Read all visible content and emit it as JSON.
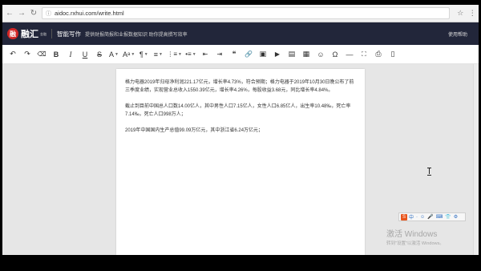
{
  "browser": {
    "url": "aidoc.rxhui.com/write.html",
    "back_icon": "arrow-left-icon",
    "forward_icon": "arrow-right-icon",
    "reload_icon": "reload-icon"
  },
  "header": {
    "logo_char": "融",
    "logo_text": "融汇",
    "logo_sub": "金融",
    "title": "智能写作",
    "description": "提供财报简报和业报数据知识 助你提高撰写效率",
    "help": "使用帮助"
  },
  "toolbar": {
    "undo": "↶",
    "redo": "↷",
    "eraser": "⌫",
    "bold": "B",
    "italic": "I",
    "underline": "U",
    "strike": "S",
    "font_color": "A",
    "font_size": "A",
    "paragraph": "¶",
    "align": "≡",
    "ordered_list": "⋮≡",
    "unordered_list": "•≡",
    "indent_dec": "⇤",
    "indent_inc": "⇥",
    "quote": "❝",
    "link": "🔗",
    "image": "▣",
    "video": "▶",
    "file": "▤",
    "table": "▦",
    "emoji": "☺",
    "special_char": "Ω",
    "hr": "—",
    "fullscreen": "⛶",
    "print": "⎙",
    "preview": "▯"
  },
  "document": {
    "paragraphs": [
      "格力电器2019年归母净利润221.17亿元，增长率4.73%，符合预期；格力电器于2019年10月30日晚公布了前三季度业绩，实现营业总收入1550.39亿元，增长率4.26%，每股收益3.68元，同比增长率4.84%。",
      "截止到目前中国总人口数14.00亿人，其中男性人口7.15亿人，女性人口6.85亿人，出生率10.48‰，死亡率7.14‰，死亡人口998万人；",
      "2019年中国国内生产总值99.09万亿元，其中浙江省6.24万亿元；"
    ]
  },
  "ime": {
    "lang": "中",
    "items": [
      "·",
      "☺",
      "🎤",
      "⌨",
      "👕",
      "⚙"
    ]
  },
  "watermark": {
    "line1": "激活 Windows",
    "line2": "转到\"设置\"以激活 Windows。"
  },
  "colors": {
    "header_bg": "#22263a",
    "logo_red": "#d32626",
    "ime_orange": "#e8541b"
  }
}
